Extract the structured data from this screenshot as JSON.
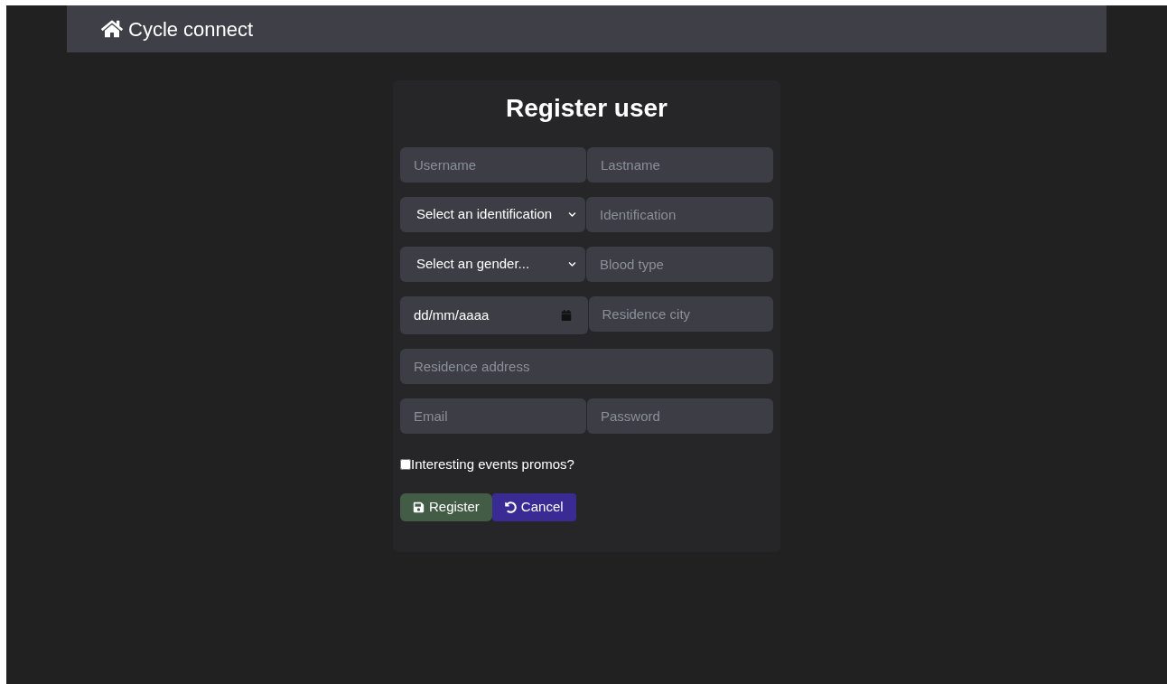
{
  "navbar": {
    "brand": "Cycle connect"
  },
  "form": {
    "title": "Register user",
    "rows": [
      [
        {
          "kind": "text",
          "placeholder": "Username"
        },
        {
          "kind": "text",
          "placeholder": "Lastname"
        }
      ],
      [
        {
          "kind": "select",
          "value": "Select an identification"
        },
        {
          "kind": "text",
          "placeholder": "Identification"
        }
      ],
      [
        {
          "kind": "select",
          "value": "Select an gender..."
        },
        {
          "kind": "text",
          "placeholder": "Blood type"
        }
      ],
      [
        {
          "kind": "date",
          "value": "dd/mm/aaaa"
        },
        {
          "kind": "text",
          "placeholder": "Residence city"
        }
      ],
      [
        {
          "kind": "text",
          "placeholder": "Residence address"
        }
      ],
      [
        {
          "kind": "text",
          "placeholder": "Email"
        },
        {
          "kind": "password",
          "placeholder": "Password"
        }
      ]
    ],
    "checkbox": {
      "label": "Interesting events promos?",
      "checked": false
    },
    "buttons": [
      {
        "kind": "register",
        "label": "Register"
      },
      {
        "kind": "cancel",
        "label": "Cancel"
      }
    ]
  }
}
